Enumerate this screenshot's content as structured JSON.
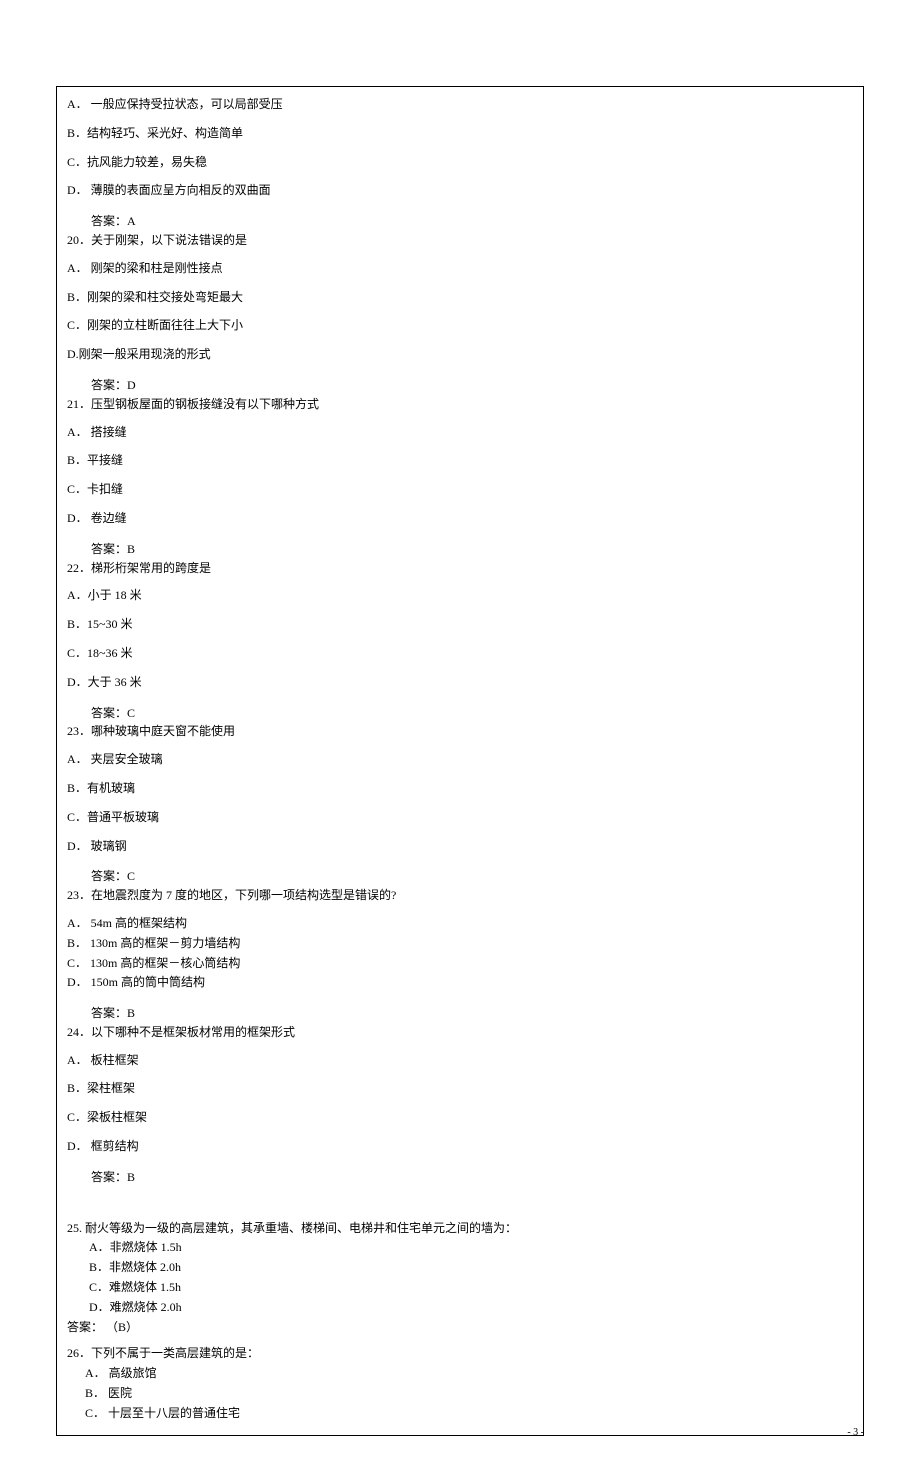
{
  "q19": {
    "opts": {
      "A": "A．   一般应保持受拉状态，可以局部受压",
      "B": "B．结构轻巧、采光好、构造简单",
      "C": "C．抗风能力较差，易失稳",
      "D": "D．  薄膜的表面应呈方向相反的双曲面"
    },
    "ans": "答案：A"
  },
  "q20": {
    "stem": "20．关于刚架，以下说法错误的是",
    "opts": {
      "A": "A．  刚架的梁和柱是刚性接点",
      "B": "B．刚架的梁和柱交接处弯矩最大",
      "C": "C．刚架的立柱断面往往上大下小",
      "D": "D.刚架一般采用现浇的形式"
    },
    "ans": "答案：D"
  },
  "q21": {
    "stem": "21．压型钢板屋面的钢板接缝没有以下哪种方式",
    "opts": {
      "A": "A．   搭接缝",
      "B": "B．平接缝",
      "C": "C．卡扣缝",
      "D": "D．   卷边缝"
    },
    "ans": "答案：B"
  },
  "q22": {
    "stem": "22．梯形桁架常用的跨度是",
    "opts": {
      "A": "A．小于 18 米",
      "B": "B．15~30 米",
      "C": "C．18~36 米",
      "D": "D．大于 36 米"
    },
    "ans": "答案：C"
  },
  "q23a": {
    "stem": "23．哪种玻璃中庭天窗不能使用",
    "opts": {
      "A": "A．  夹层安全玻璃",
      "B": "B．有机玻璃",
      "C": "C．普通平板玻璃",
      "D": "D．  玻璃钢"
    },
    "ans": "答案：C"
  },
  "q23b": {
    "stem": "23．在地震烈度为 7 度的地区，下列哪一项结构选型是错误的?",
    "opts": {
      "A": "A．   54m 高的框架结构",
      "B": "B．   130m 高的框架－剪力墙结构",
      "C": "C．   130m 高的框架－核心筒结构",
      "D": "D．   150m 高的筒中筒结构"
    },
    "ans": "答案：B"
  },
  "q24": {
    "stem": "24．以下哪种不是框架板材常用的框架形式",
    "opts": {
      "A": "A．  板柱框架",
      "B": "B．梁柱框架",
      "C": "C．梁板柱框架",
      "D": "D．  框剪结构"
    },
    "ans": "答案：B"
  },
  "q25": {
    "stem": "25. 耐火等级为一级的高层建筑，其承重墙、楼梯间、电梯井和住宅单元之间的墙为：",
    "opts": {
      "A": "A．非燃烧体 1.5h",
      "B": "B．非燃烧体 2.0h",
      "C": "C．难燃烧体 1.5h",
      "D": "D．难燃烧体 2.0h"
    },
    "ans": "答案： （B）"
  },
  "q26": {
    "stem": "26．下列不属于一类高层建筑的是：",
    "opts": {
      "A": "A．   高级旅馆",
      "B": "B．   医院",
      "C": "C．   十层至十八层的普通住宅"
    }
  },
  "footer": "- 3 -"
}
